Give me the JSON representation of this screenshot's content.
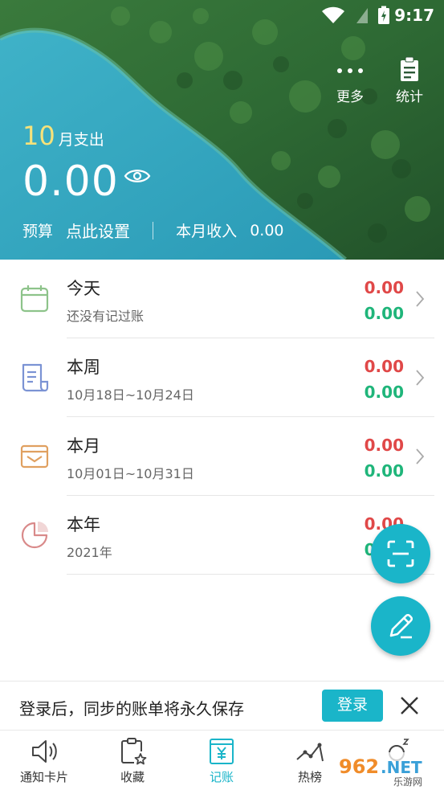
{
  "status_bar": {
    "time": "9:17"
  },
  "header": {
    "more_label": "更多",
    "stats_label": "统计",
    "month_number": "10",
    "month_unit": "月支出",
    "total_expense": "0.00",
    "budget_label": "预算",
    "budget_action": "点此设置",
    "income_label": "本月收入",
    "income_value": "0.00"
  },
  "summary_rows": [
    {
      "title": "今天",
      "subtitle": "还没有记过账",
      "expense": "0.00",
      "income": "0.00",
      "icon": "calendar-icon",
      "icon_color": "#8dc38a"
    },
    {
      "title": "本周",
      "subtitle": "10月18日~10月24日",
      "expense": "0.00",
      "income": "0.00",
      "icon": "document-icon",
      "icon_color": "#7b93d4"
    },
    {
      "title": "本月",
      "subtitle": "10月01日~10月31日",
      "expense": "0.00",
      "income": "0.00",
      "icon": "wallet-icon",
      "icon_color": "#e0a060"
    },
    {
      "title": "本年",
      "subtitle": "2021年",
      "expense": "0.00",
      "income": "0.00",
      "icon": "pie-chart-icon",
      "icon_color": "#d98a8a"
    }
  ],
  "banner": {
    "message": "登录后，同步的账单将永久保存",
    "login_label": "登录"
  },
  "nav": {
    "tabs": [
      {
        "label": "通知卡片",
        "icon": "speaker-icon"
      },
      {
        "label": "收藏",
        "icon": "clipboard-star-icon"
      },
      {
        "label": "记账",
        "icon": "ledger-yen-icon"
      },
      {
        "label": "热榜",
        "icon": "trend-icon"
      },
      {
        "label": "",
        "icon": "sleep-icon"
      }
    ],
    "active_index": 2
  },
  "colors": {
    "accent": "#1ab5c9",
    "expense": "#e04848",
    "income": "#1fb57a",
    "month_highlight": "#f6e27a"
  }
}
